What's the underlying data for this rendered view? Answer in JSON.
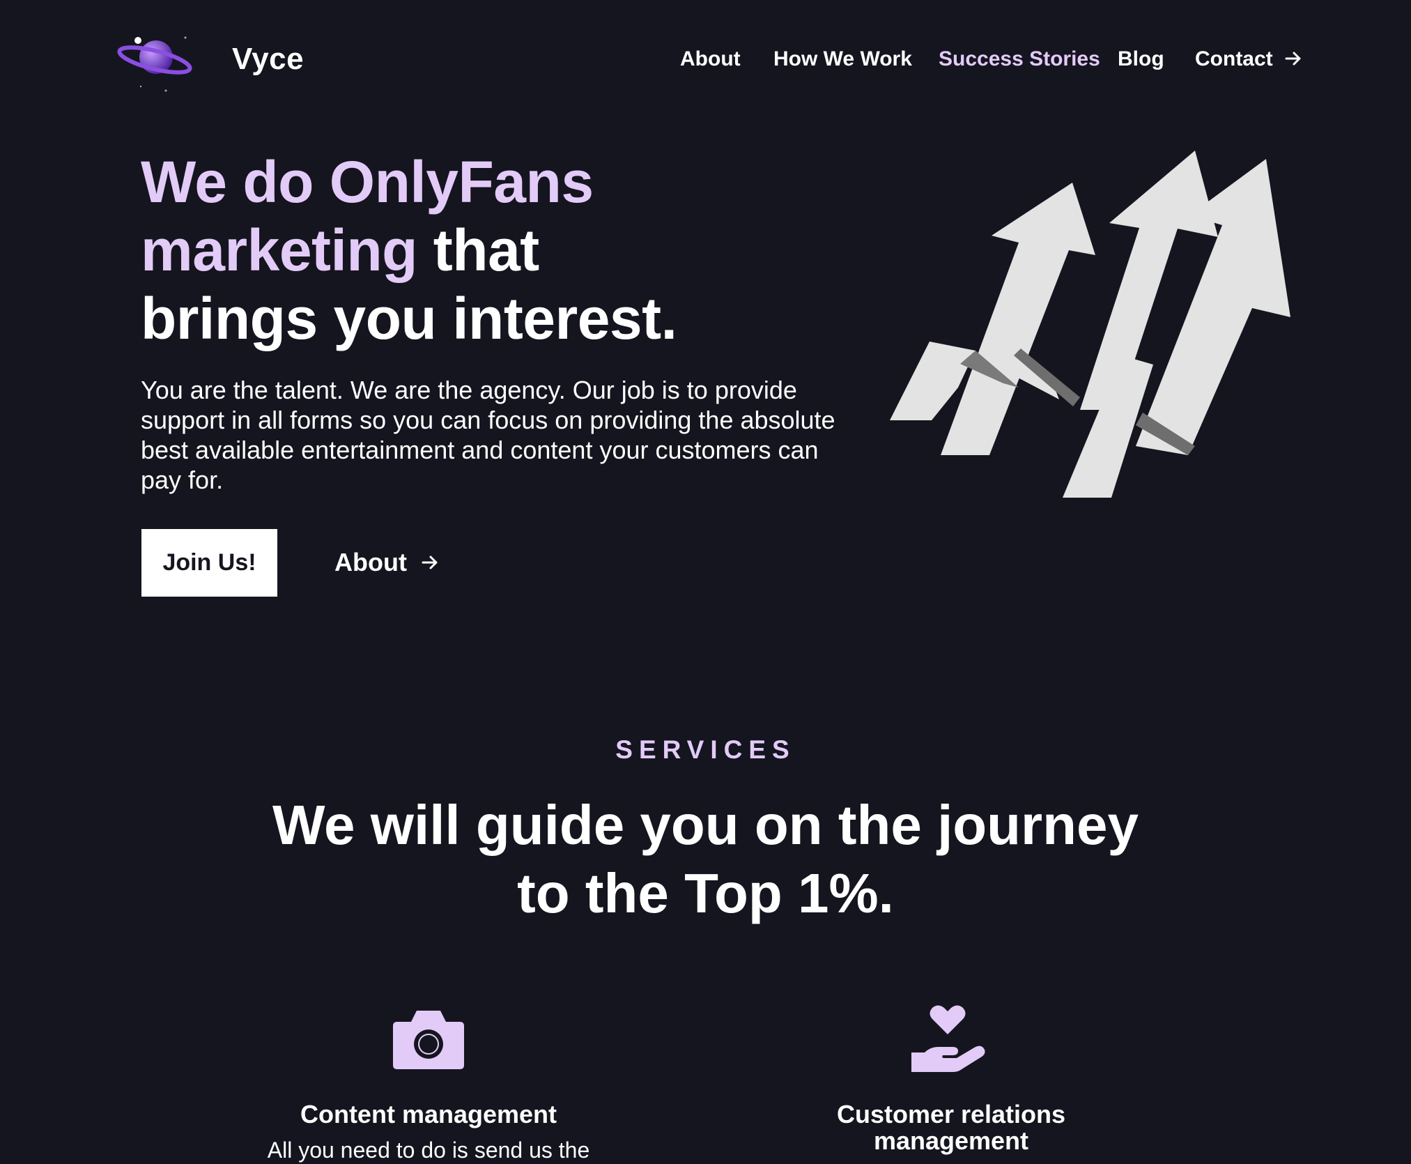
{
  "header": {
    "brand": "Vyce",
    "logo_icon": "planet-icon",
    "nav": [
      {
        "label": "About",
        "active": false
      },
      {
        "label": "How We Work",
        "active": false
      },
      {
        "label": "Success Stories",
        "active": true
      },
      {
        "label": "Blog",
        "active": false
      },
      {
        "label": "Contact",
        "active": false,
        "icon": "arrow-right-icon"
      }
    ]
  },
  "hero": {
    "title_highlight_1": "We do OnlyFans",
    "title_highlight_2": "marketing",
    "title_rest_1": " that",
    "title_rest_2": "brings you interest.",
    "description": "You are the talent. We are the agency. Our job is to provide support in all forms so you can focus on providing the absolute best available entertainment and content your customers can pay for.",
    "primary_button": "Join Us!",
    "secondary_link": "About",
    "graphic_icon": "growth-arrows-icon"
  },
  "services": {
    "eyebrow": "SERVICES",
    "title_line_1": "We will guide you on the journey",
    "title_line_2": "to the Top 1%.",
    "items": [
      {
        "icon": "camera-icon",
        "title": "Content management",
        "description": "All you need to do is send us the"
      },
      {
        "icon": "heart-hand-icon",
        "title": "Customer relations management",
        "description": ""
      }
    ]
  },
  "colors": {
    "background": "#15151f",
    "accent": "#e3cbf8",
    "text": "#ffffff",
    "button_bg": "#ffffff",
    "logo_purple": "#8a4fe0"
  }
}
